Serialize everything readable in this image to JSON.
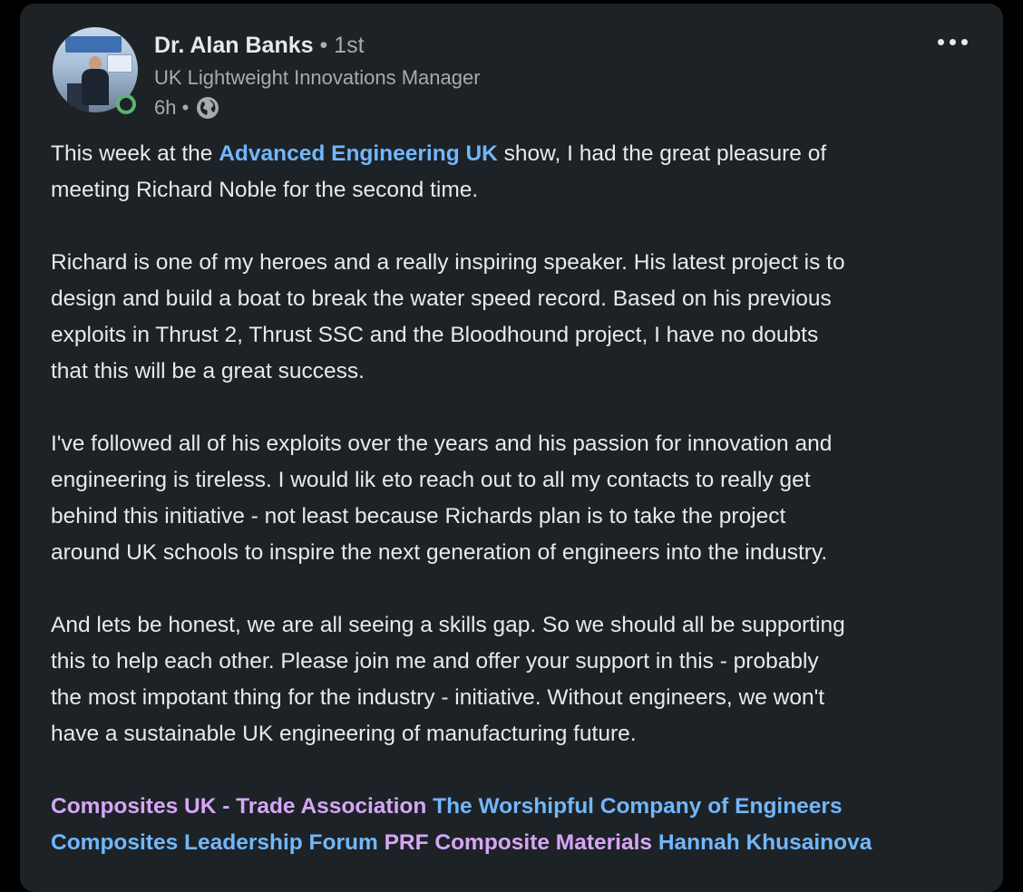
{
  "author": {
    "name": "Dr. Alan Banks",
    "degree": "• 1st",
    "headline": "UK Lightweight Innovations Manager",
    "time": "6h •"
  },
  "post": {
    "p1_before": "This week at the ",
    "p1_link": "Advanced Engineering UK",
    "p1_line1_after": " show, I had the great pleasure of",
    "p1_line2": "meeting Richard Noble for the second time.",
    "p2": [
      "Richard is one of my heroes and a really inspiring speaker. His latest project is to",
      "design and build a boat to break the water speed record. Based on his previous",
      "exploits in Thrust 2, Thrust SSC and the Bloodhound project, I have no doubts",
      "that this will be a great success."
    ],
    "p3": [
      "I've followed all of his exploits over the years and his passion for innovation and",
      "engineering is tireless. I would lik eto reach out to all my contacts to really get",
      "behind this initiative - not least because Richards plan is to take the project",
      "around UK schools to inspire the next generation of engineers into the industry."
    ],
    "p4": [
      "And lets be honest, we are all seeing a skills gap. So we should all be supporting",
      "this to help each other. Please join me and offer your support in this - probably",
      "the most impotant thing for the industry - initiative. Without engineers, we won't",
      "have a sustainable UK engineering of manufacturing future."
    ],
    "tags": [
      "Composites UK - Trade Association",
      "The Worshipful Company of Engineers",
      "Composites Leadership Forum",
      "PRF Composite Materials",
      "Hannah Khusainova"
    ]
  },
  "colors": {
    "card_bg": "#1d2226",
    "link_blue": "#71b7fb",
    "link_purple": "#d7a6f7",
    "online_green": "#5bb472"
  },
  "icons": {
    "globe": "globe-icon",
    "more": "more-options-icon"
  }
}
